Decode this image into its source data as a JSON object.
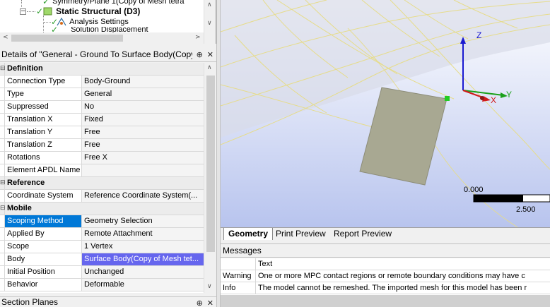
{
  "tree": {
    "item_symmetry": "Symmetry/Plane 1(Copy of Mesh tetra",
    "item_static": "Static Structural (D3)",
    "item_analysis": "Analysis Settings",
    "item_solution": "Solution Displacement"
  },
  "details": {
    "title": "Details of \"General - Ground To Surface Body(Copy of...",
    "pin_icon": "pin-icon",
    "close_icon": "close-icon",
    "groups": [
      {
        "label": "Definition"
      },
      {
        "label": "Reference"
      },
      {
        "label": "Mobile"
      }
    ],
    "rows": [
      {
        "name": "Connection Type",
        "value": "Body-Ground"
      },
      {
        "name": "Type",
        "value": "General"
      },
      {
        "name": "Suppressed",
        "value": "No"
      },
      {
        "name": "Translation X",
        "value": "Fixed"
      },
      {
        "name": "Translation Y",
        "value": "Free"
      },
      {
        "name": "Translation Z",
        "value": "Free"
      },
      {
        "name": "Rotations",
        "value": "Free X"
      },
      {
        "name": "Element APDL Name",
        "value": ""
      },
      {
        "name": "Coordinate System",
        "value": "Reference Coordinate System(..."
      },
      {
        "name": "Scoping Method",
        "value": "Geometry Selection"
      },
      {
        "name": "Applied By",
        "value": "Remote Attachment"
      },
      {
        "name": "Scope",
        "value": "1 Vertex"
      },
      {
        "name": "Body",
        "value": "Surface Body(Copy of Mesh tet..."
      },
      {
        "name": "Initial Position",
        "value": "Unchanged"
      },
      {
        "name": "Behavior",
        "value": "Deformable"
      }
    ]
  },
  "section_planes": {
    "title": "Section Planes"
  },
  "viewport": {
    "axis_x": "X",
    "axis_y": "Y",
    "axis_z": "Z",
    "scale_start": "0.000",
    "scale_end": "2.500"
  },
  "tabs": [
    "Geometry",
    "Print Preview",
    "Report Preview"
  ],
  "messages": {
    "title": "Messages",
    "col_text": "Text",
    "rows": [
      {
        "type": "Warning",
        "text": "One or more MPC contact regions or remote boundary conditions may have c"
      },
      {
        "type": "Info",
        "text": "The model cannot be remeshed.  The imported mesh for this model has been r"
      }
    ]
  },
  "colors": {
    "selection_blue": "#0078d7",
    "selected_value": "#6666ee",
    "body_fill": "#a8a892",
    "sky_top": "#ffffff",
    "sky_bottom": "#b8c4ee"
  }
}
